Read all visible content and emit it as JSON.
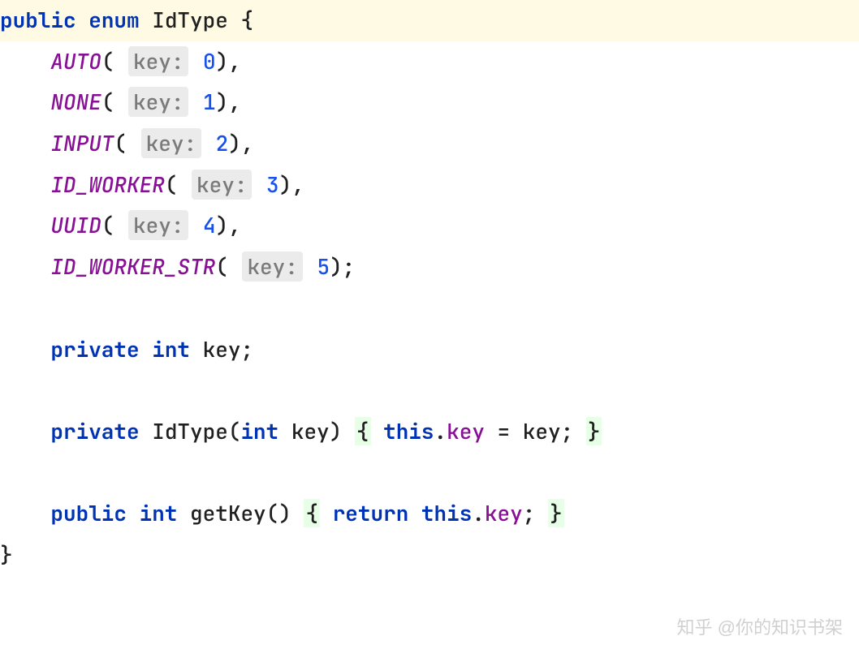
{
  "code": {
    "keywords": {
      "public": "public",
      "enum": "enum",
      "private": "private",
      "int": "int",
      "this": "this",
      "return": "return"
    },
    "className": "IdType",
    "enumConstants": [
      {
        "name": "AUTO",
        "hint": "key:",
        "value": "0",
        "terminator": ","
      },
      {
        "name": "NONE",
        "hint": "key:",
        "value": "1",
        "terminator": ","
      },
      {
        "name": "INPUT",
        "hint": "key:",
        "value": "2",
        "terminator": ","
      },
      {
        "name": "ID_WORKER",
        "hint": "key:",
        "value": "3",
        "terminator": ","
      },
      {
        "name": "UUID",
        "hint": "key:",
        "value": "4",
        "terminator": ","
      },
      {
        "name": "ID_WORKER_STR",
        "hint": "key:",
        "value": "5",
        "terminator": ";"
      }
    ],
    "fieldDecl": {
      "name": "key"
    },
    "constructor": {
      "paramName": "key",
      "assignField": "key",
      "assignValue": "key"
    },
    "getter": {
      "name": "getKey",
      "returnField": "key"
    },
    "braces": {
      "open": "{",
      "close": "}"
    }
  },
  "watermark": "知乎 @你的知识书架"
}
